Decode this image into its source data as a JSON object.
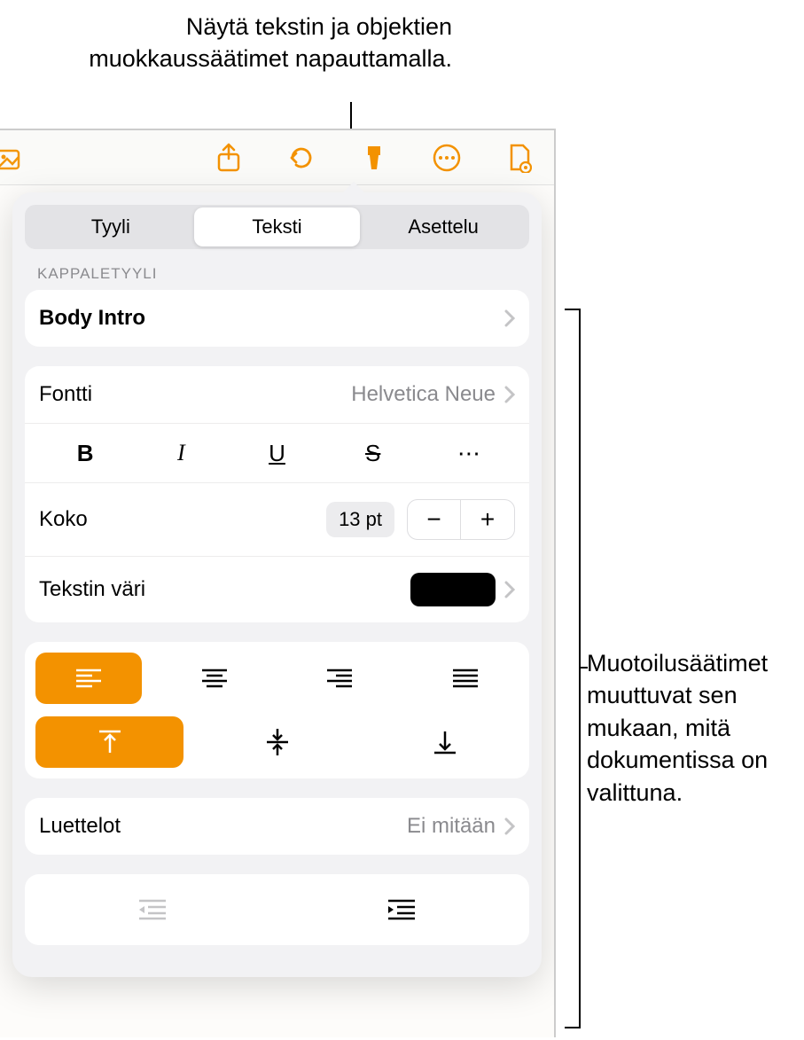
{
  "callouts": {
    "top": "Näytä tekstin ja objektien muokkaussäätimet napauttamalla.",
    "right": "Muotoilusäätimet muuttuvat sen mukaan, mitä dokumentissa on valittuna."
  },
  "tabs": {
    "style": "Tyyli",
    "text": "Teksti",
    "layout": "Asettelu"
  },
  "sections": {
    "paragraph_style": "KAPPALETYYLI"
  },
  "paragraph_style": {
    "value": "Body Intro"
  },
  "font": {
    "label": "Fontti",
    "value": "Helvetica Neue"
  },
  "size": {
    "label": "Koko",
    "value": "13 pt"
  },
  "text_color": {
    "label": "Tekstin väri",
    "value": "#000000"
  },
  "lists": {
    "label": "Luettelot",
    "value": "Ei mitään"
  },
  "stepper": {
    "minus": "−",
    "plus": "+"
  },
  "text_styles": {
    "bold": "B",
    "italic": "I",
    "underline": "U",
    "strike": "S",
    "more": "⋯"
  }
}
